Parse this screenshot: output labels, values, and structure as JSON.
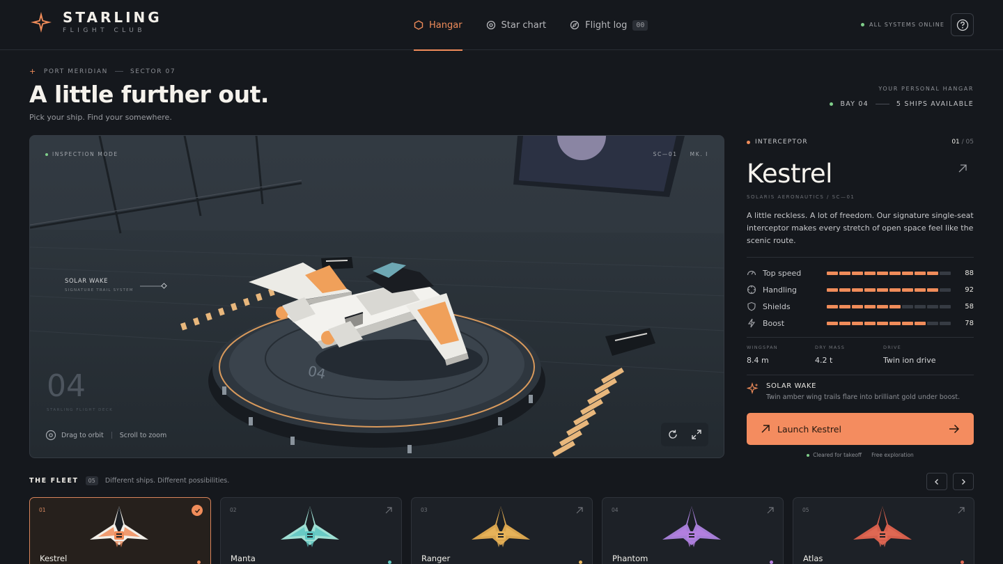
{
  "brand": {
    "name": "STARLING",
    "sub": "FLIGHT CLUB"
  },
  "nav": {
    "items": [
      {
        "label": "Hangar",
        "active": true,
        "icon": "hexagon-icon"
      },
      {
        "label": "Star chart",
        "active": false,
        "icon": "target-icon"
      },
      {
        "label": "Flight log",
        "active": false,
        "icon": "compass-icon",
        "badge": "00"
      }
    ]
  },
  "status": {
    "label": "ALL SYSTEMS ONLINE"
  },
  "hero": {
    "crumbs": [
      "PORT MERIDIAN",
      "SECTOR 07"
    ],
    "title": "A little further out.",
    "subtitle": "Pick your ship. Find your somewhere.",
    "hangar_label": "YOUR PERSONAL HANGAR",
    "bay": "BAY 04",
    "ships_available": "5 SHIPS AVAILABLE"
  },
  "viewport": {
    "mode": "INSPECTION MODE",
    "code": "SC—01",
    "mark": "MK. I",
    "callout_title": "SOLAR WAKE",
    "callout_sub": "SIGNATURE TRAIL SYSTEM",
    "bay_number": "04",
    "bay_name": "STARLING FLIGHT DECK",
    "pad_number": "04",
    "hint_orbit": "Drag to orbit",
    "hint_zoom": "Scroll to zoom"
  },
  "detail": {
    "class": "INTERCEPTOR",
    "index": "01",
    "total": "/ 05",
    "name": "Kestrel",
    "maker": "SOLARIS AERONAUTICS  /  SC—01",
    "description": "A little reckless. A lot of freedom. Our signature single-seat interceptor makes every stretch of open space feel like the scenic route.",
    "stats": [
      {
        "label": "Top speed",
        "value": 88,
        "icon": "speedometer-icon"
      },
      {
        "label": "Handling",
        "value": 92,
        "icon": "crosshair-icon"
      },
      {
        "label": "Shields",
        "value": 58,
        "icon": "shield-icon"
      },
      {
        "label": "Boost",
        "value": 78,
        "icon": "bolt-icon"
      }
    ],
    "specs": [
      {
        "label": "WINGSPAN",
        "value": "8.4 m"
      },
      {
        "label": "DRY MASS",
        "value": "4.2 t"
      },
      {
        "label": "DRIVE",
        "value": "Twin ion drive"
      }
    ],
    "feature_title": "SOLAR WAKE",
    "feature_desc": "Twin amber wing trails flare into brilliant gold under boost.",
    "launch_label": "Launch Kestrel",
    "note_cleared": "Cleared for takeoff",
    "note_free": "Free exploration"
  },
  "fleet": {
    "title": "THE FLEET",
    "count": "05",
    "subtitle": "Different ships. Different possibilities.",
    "ships": [
      {
        "index": "01",
        "name": "Kestrel",
        "selected": true,
        "accent": "#f08c5a",
        "body": "#f2efe9"
      },
      {
        "index": "02",
        "name": "Manta",
        "selected": false,
        "accent": "#5fc6c2",
        "body": "#9fe0d4"
      },
      {
        "index": "03",
        "name": "Ranger",
        "selected": false,
        "accent": "#e8b45a",
        "body": "#d9a54f"
      },
      {
        "index": "04",
        "name": "Phantom",
        "selected": false,
        "accent": "#b47fe0",
        "body": "#a57ed6"
      },
      {
        "index": "05",
        "name": "Atlas",
        "selected": false,
        "accent": "#e06a55",
        "body": "#d55f4c"
      }
    ]
  },
  "colors": {
    "accent": "#f08c5a",
    "online": "#7fce8a",
    "background": "#15181d"
  }
}
